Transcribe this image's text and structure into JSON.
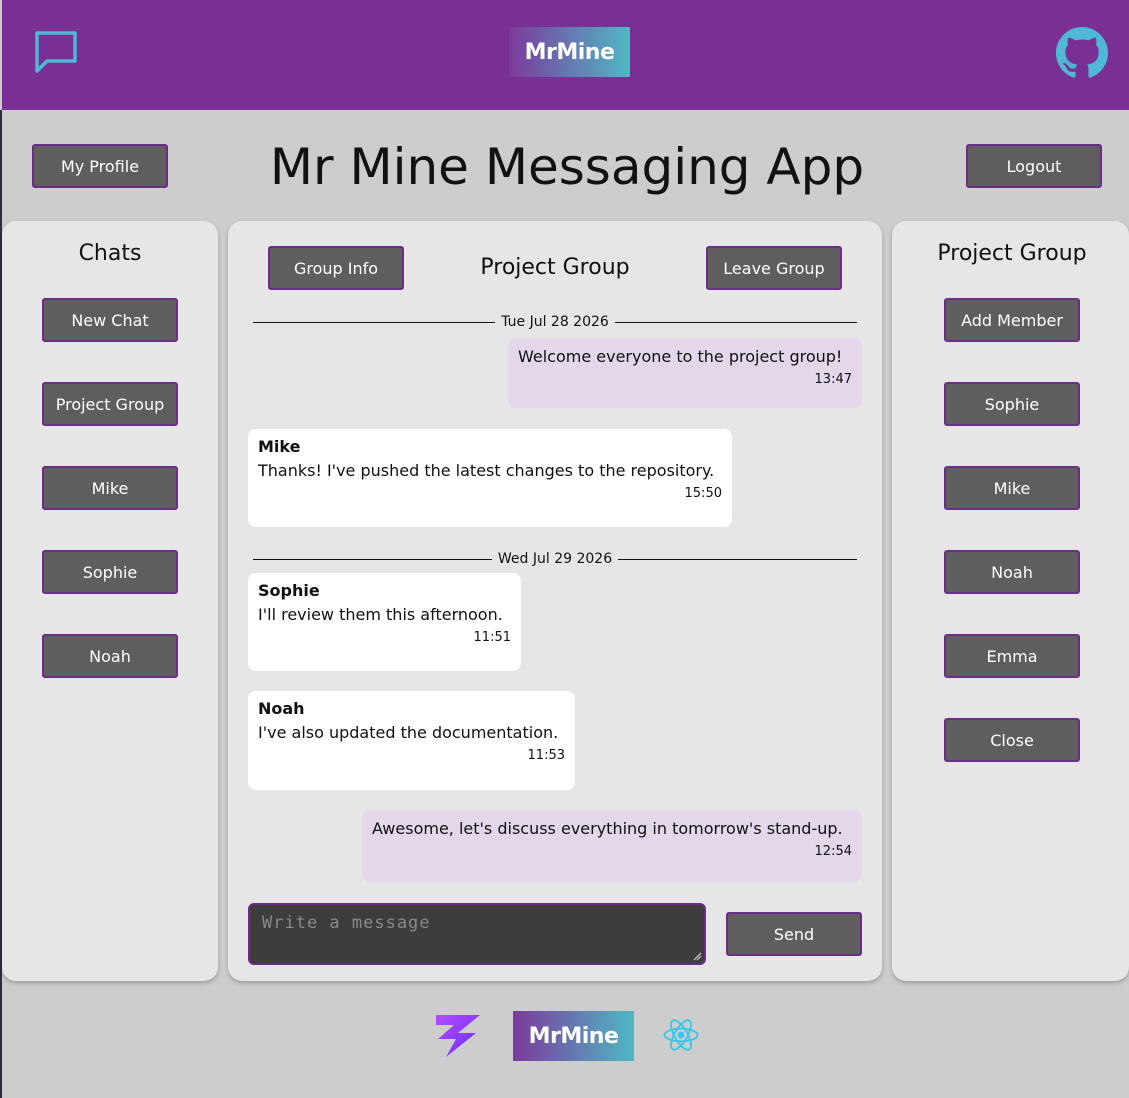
{
  "header": {
    "logo_text": "MrMine",
    "chat_icon": "chat-bubble-icon",
    "github_icon": "github-icon"
  },
  "top": {
    "profile_label": "My Profile",
    "title": "Mr Mine Messaging App",
    "logout_label": "Logout"
  },
  "chats_panel": {
    "heading": "Chats",
    "new_chat_label": "New Chat",
    "items": [
      "Project Group",
      "Mike",
      "Sophie",
      "Noah"
    ]
  },
  "conversation": {
    "group_info_label": "Group Info",
    "name": "Project Group",
    "leave_label": "Leave Group",
    "dates": [
      "Tue Jul 28 2026",
      "Wed Jul 29 2026"
    ],
    "messages": [
      {
        "sender": "",
        "text": "Welcome everyone to the project group!",
        "time": "13:47",
        "mine": true
      },
      {
        "sender": "Mike",
        "text": "Thanks! I've pushed the latest changes to the repository.",
        "time": "15:50",
        "mine": false
      },
      {
        "sender": "Sophie",
        "text": "I'll review them this afternoon.",
        "time": "11:51",
        "mine": false
      },
      {
        "sender": "Noah",
        "text": "I've also updated the documentation.",
        "time": "11:53",
        "mine": false
      },
      {
        "sender": "",
        "text": "Awesome, let's discuss everything in tomorrow's stand-up.",
        "time": "12:54",
        "mine": true
      }
    ],
    "input_placeholder": "Write a message",
    "send_label": "Send"
  },
  "members_panel": {
    "heading": "Project Group",
    "add_member_label": "Add Member",
    "members": [
      "Sophie",
      "Mike",
      "Noah",
      "Emma"
    ],
    "close_label": "Close"
  },
  "footer": {
    "logo_text": "MrMine"
  },
  "colors": {
    "header_bg": "#7a2f94",
    "button_bg": "#5e5e5e",
    "button_border": "#6b2c86",
    "own_message_bg": "#e3d7e9",
    "other_message_bg": "#ffffff",
    "accent_icon": "#4fb8d4"
  }
}
